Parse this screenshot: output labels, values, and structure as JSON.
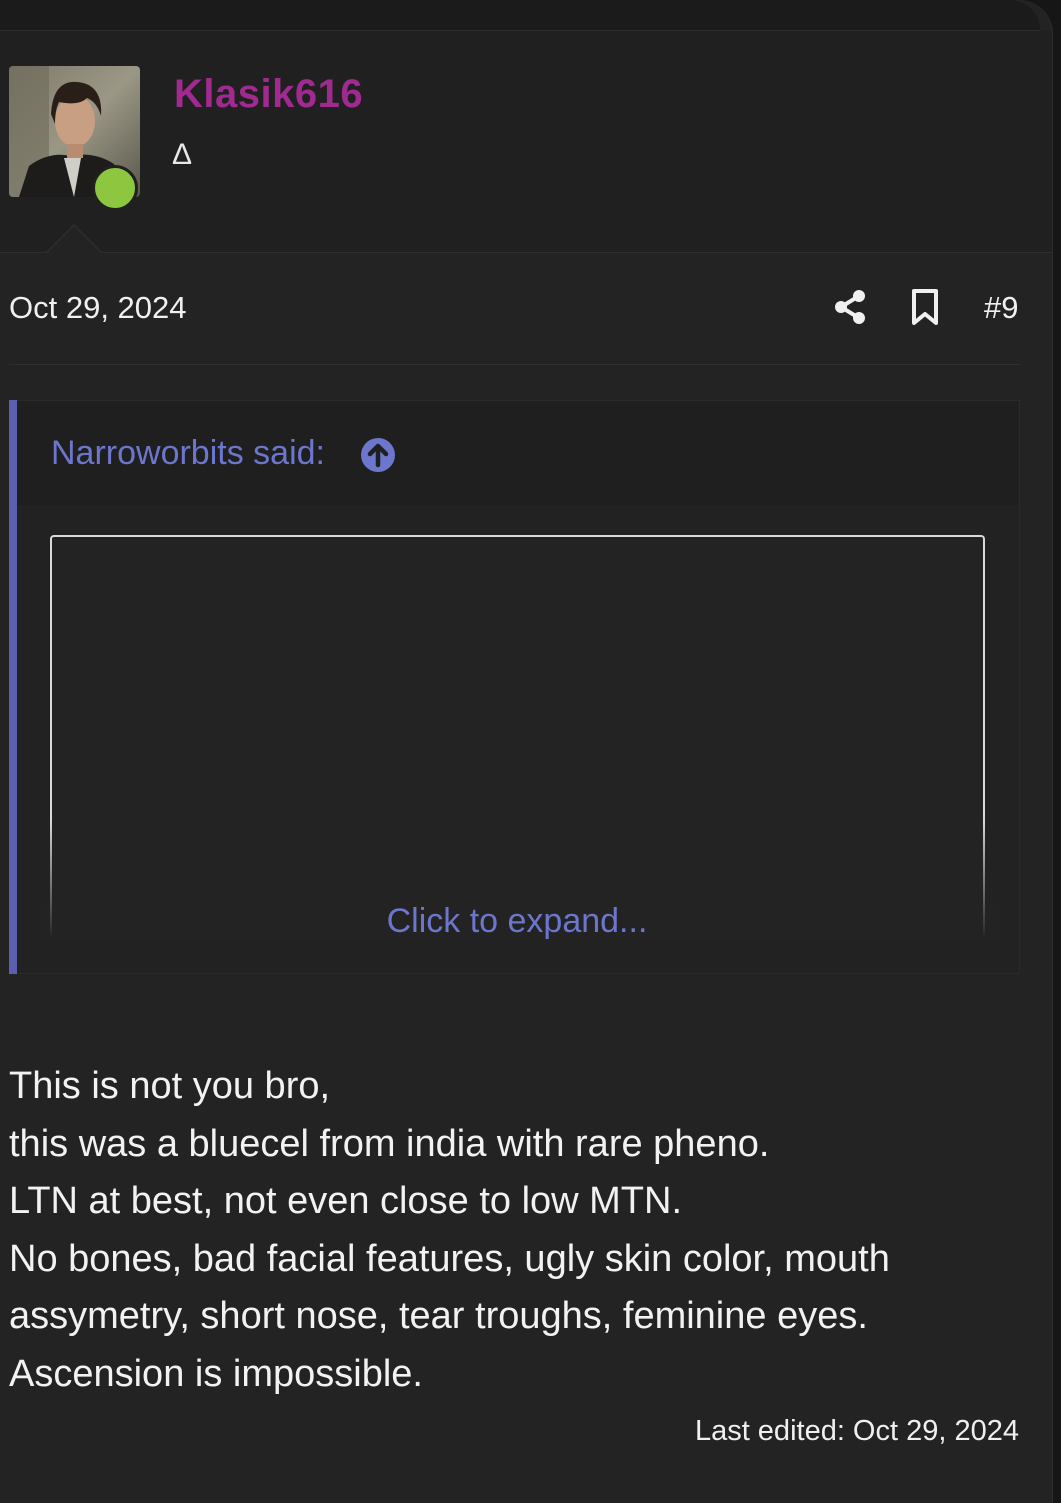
{
  "user": {
    "name": "Klasik616",
    "title": "Δ",
    "online": true,
    "name_color": "#a02a8f",
    "online_color": "#8dc63f"
  },
  "post": {
    "date": "Oct 29, 2024",
    "number": "#9",
    "last_edited": "Last edited: Oct 29, 2024",
    "body_lines": [
      "This is not you bro,",
      "this was a bluecel from india with rare pheno.",
      "LTN at best, not even close to low MTN.",
      "No bones, bad facial features, ugly skin color, mouth",
      "assymetry, short nose, tear troughs, feminine eyes.",
      "Ascension is impossible."
    ]
  },
  "quote": {
    "author": "Narroworbits said:",
    "expand_label": "Click to expand...",
    "accent_color": "#5b5fb0"
  },
  "icons": {
    "share": "share-icon",
    "bookmark": "bookmark-icon",
    "quote_up": "arrow-up-circle-icon"
  }
}
